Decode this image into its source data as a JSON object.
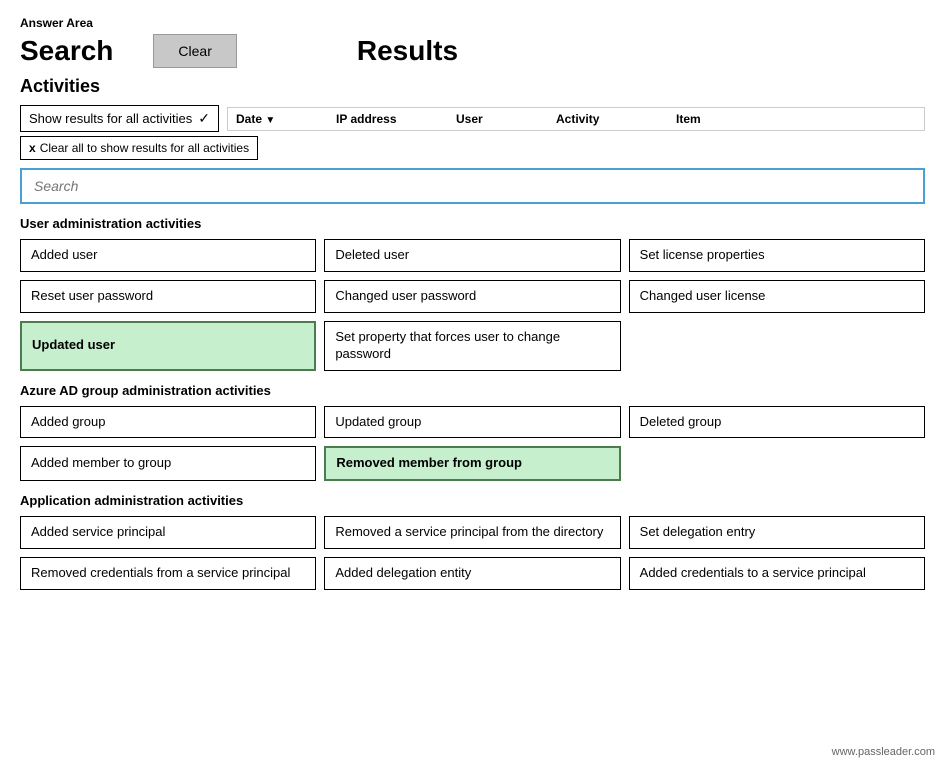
{
  "answerArea": {
    "label": "Answer Area"
  },
  "header": {
    "searchTitle": "Search",
    "clearButton": "Clear",
    "resultsTitle": "Results"
  },
  "activitiesSection": {
    "label": "Activities",
    "dropdown": {
      "label": "Show results for all activities",
      "icon": "checkmark"
    },
    "columnHeaders": [
      {
        "label": "Date",
        "hasSortArrow": true
      },
      {
        "label": "IP address",
        "hasSortArrow": false
      },
      {
        "label": "User",
        "hasSortArrow": false
      },
      {
        "label": "Activity",
        "hasSortArrow": false
      },
      {
        "label": "Item",
        "hasSortArrow": false
      }
    ],
    "clearTag": {
      "xLabel": "x",
      "label": "Clear all to show results for all activities"
    },
    "searchPlaceholder": "Search"
  },
  "userAdminSection": {
    "label": "User administration activities",
    "items": [
      {
        "label": "Added user",
        "selected": false,
        "col": 1
      },
      {
        "label": "Deleted user",
        "selected": false,
        "col": 2
      },
      {
        "label": "Set license properties",
        "selected": false,
        "col": 3
      },
      {
        "label": "Reset user password",
        "selected": false,
        "col": 1
      },
      {
        "label": "Changed user password",
        "selected": false,
        "col": 2
      },
      {
        "label": "Changed user license",
        "selected": false,
        "col": 3
      },
      {
        "label": "Updated user",
        "selected": true,
        "col": 1
      },
      {
        "label": "Set property that forces user to change password",
        "selected": false,
        "col": 2
      }
    ]
  },
  "azureADSection": {
    "label": "Azure AD group administration activities",
    "items": [
      {
        "label": "Added group",
        "selected": false,
        "col": 1
      },
      {
        "label": "Updated group",
        "selected": false,
        "col": 2
      },
      {
        "label": "Deleted group",
        "selected": false,
        "col": 3
      },
      {
        "label": "Added member to group",
        "selected": false,
        "col": 1
      },
      {
        "label": "Removed member from group",
        "selected": true,
        "col": 2
      }
    ]
  },
  "appAdminSection": {
    "label": "Application administration activities",
    "items": [
      {
        "label": "Added service principal",
        "selected": false,
        "col": 1
      },
      {
        "label": "Removed a service principal from the directory",
        "selected": false,
        "col": 2
      },
      {
        "label": "Set delegation entry",
        "selected": false,
        "col": 3
      },
      {
        "label": "Removed credentials from a service principal",
        "selected": false,
        "col": 1
      },
      {
        "label": "Added delegation entity",
        "selected": false,
        "col": 2
      },
      {
        "label": "Added credentials to a service principal",
        "selected": false,
        "col": 3
      }
    ]
  },
  "watermark": "www.passleader.com"
}
